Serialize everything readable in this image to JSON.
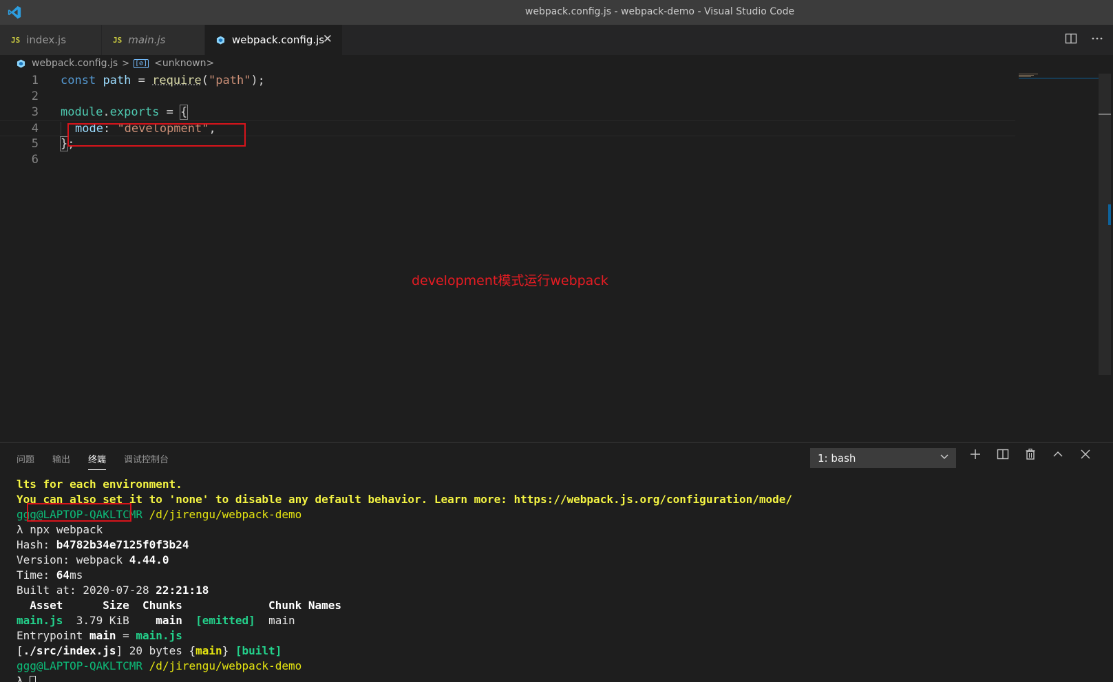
{
  "window": {
    "title": "webpack.config.js - webpack-demo - Visual Studio Code"
  },
  "tabs": [
    {
      "label": "index.js",
      "icon": "js-icon",
      "badge": "JS",
      "active": false,
      "italic": false
    },
    {
      "label": "main.js",
      "icon": "js-icon",
      "badge": "JS",
      "active": false,
      "italic": true
    },
    {
      "label": "webpack.config.js",
      "icon": "webpack-config-icon",
      "active": true,
      "close": "✕"
    }
  ],
  "breadcrumb": {
    "file": "webpack.config.js",
    "symbol_icon": "[⊘]",
    "symbol": "<unknown>"
  },
  "editor": {
    "line_numbers": [
      "1",
      "2",
      "3",
      "4",
      "5",
      "6"
    ],
    "line1": {
      "kw": "const",
      "var": "path",
      "eq": " = ",
      "fn": "require",
      "open": "(",
      "str": "\"path\"",
      "close": ");"
    },
    "line3": {
      "obj": "module",
      "dot": ".",
      "prop": "exports",
      "eq": " = ",
      "brace": "{"
    },
    "line4": {
      "key": "mode",
      "colon": ": ",
      "str": "\"development\"",
      "comma": ","
    },
    "line5": {
      "brace": "}",
      "semi": ";"
    }
  },
  "annotation": "development模式运行webpack",
  "panel": {
    "tabs": [
      "问题",
      "输出",
      "终端",
      "调试控制台"
    ],
    "active_tab": "终端",
    "terminal_select": "1: bash",
    "actions": [
      "plus-icon",
      "split-icon",
      "trash-icon",
      "chevron-up-icon",
      "close-icon"
    ]
  },
  "terminal": {
    "warn1": "lts for each environment.",
    "warn2": "You can also set it to 'none' to disable any default behavior. Learn more: https://webpack.js.org/configuration/mode/",
    "prompt_user": "ggg@LAPTOP-QAKLTCMR",
    "prompt_path": "/d/jirengu/webpack-demo",
    "lambda": "λ",
    "command": "npx webpack",
    "hash_label": "Hash: ",
    "hash_value": "b4782b34e7125f0f3b24",
    "version_label": "Version: webpack ",
    "version_value": "4.44.0",
    "time_label": "Time: ",
    "time_value": "64",
    "time_unit": "ms",
    "built_label": "Built at: 2020-07-28 ",
    "built_time": "22:21:18",
    "table_header": "  Asset      Size  Chunks             Chunk Names",
    "row_asset": "main.js",
    "row_size": "  3.79 KiB    ",
    "row_chunk": "main",
    "row_emitted": "  [emitted]",
    "row_names": "  main",
    "entry_label": "Entrypoint ",
    "entry_name": "main",
    "entry_eq": " = ",
    "entry_file": "main.js",
    "module_open": "[",
    "module_path": "./src/index.js",
    "module_close": "] 20 bytes {",
    "module_chunk": "main",
    "module_end": "} ",
    "module_built": "[built]"
  }
}
